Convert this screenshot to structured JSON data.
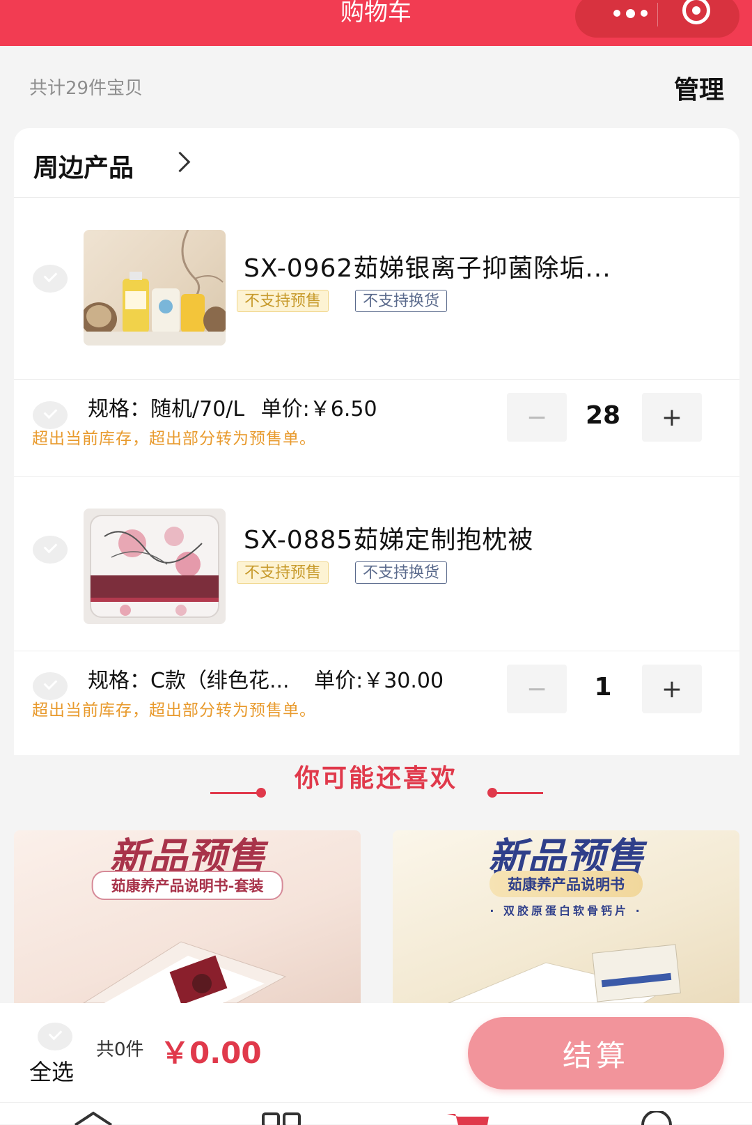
{
  "header": {
    "title": "购物车",
    "more_icon": "more-dots-icon",
    "close_icon": "target-circle-icon"
  },
  "summary": {
    "count_text": "共计29件宝贝",
    "manage_label": "管理"
  },
  "store": {
    "name": "周边产品",
    "items": [
      {
        "name": "SX-0962茹娣银离子抑菌除垢...",
        "tags": [
          "不支持预售",
          "不支持换货"
        ],
        "spec": "规格：随机/70/L",
        "price_label": "单价:",
        "price": "￥6.50",
        "warning": "超出当前库存，超出部分转为预售单。",
        "quantity": "28"
      },
      {
        "name": "SX-0885茹娣定制抱枕被",
        "tags": [
          "不支持预售",
          "不支持换货"
        ],
        "spec": "规格：C款（绯色花...",
        "price_label": "单价:",
        "price": "￥30.00",
        "warning": "超出当前库存，超出部分转为预售单。",
        "quantity": "1"
      }
    ],
    "minus_label": "−",
    "plus_label": "+"
  },
  "recommend": {
    "title": "你可能还喜欢",
    "cards": [
      {
        "headline": "新品预售",
        "subtitle": "茹康养产品说明书-套装",
        "extra": ""
      },
      {
        "headline": "新品预售",
        "subtitle": "茹康养产品说明书",
        "extra": "· 双胶原蛋白软骨钙片 ·"
      }
    ]
  },
  "bottom": {
    "select_all_label": "全选",
    "count_text": "共0件",
    "total_price": "￥0.00",
    "checkout_label": "结算"
  },
  "colors": {
    "brand_red": "#f23c52",
    "price_red": "#e0394b",
    "checkout_pink": "#f2949b",
    "warning_orange": "#e89a2d"
  }
}
